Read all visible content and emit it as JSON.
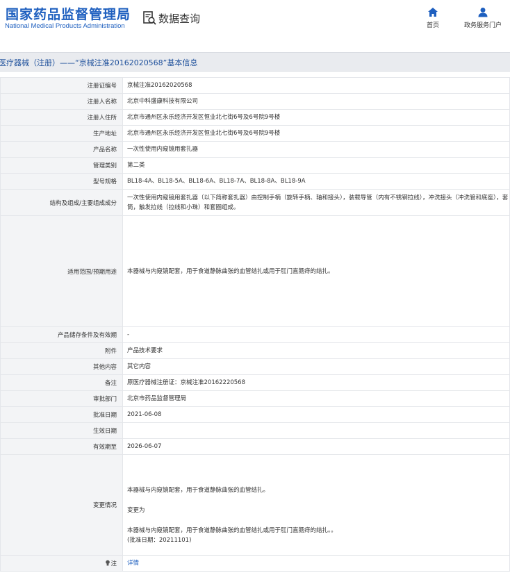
{
  "header": {
    "logo_cn": "国家药品监督管理局",
    "logo_en": "National Medical Products Administration",
    "data_query_label": "数据查询",
    "nav": [
      {
        "label": "首页",
        "icon": "home-icon"
      },
      {
        "label": "政务服务门户",
        "icon": "user-icon"
      }
    ]
  },
  "page": {
    "title": "医疗器械（注册）——“京械注准20162020568”基本信息"
  },
  "fields": {
    "reg_no": {
      "label": "注册证编号",
      "value": "京械注准20162020568"
    },
    "registrant": {
      "label": "注册人名称",
      "value": "北京中科盛康科技有限公司"
    },
    "registrant_addr": {
      "label": "注册人住所",
      "value": "北京市通州区永乐经济开发区恒业北七街6号及6号院9号楼"
    },
    "production_addr": {
      "label": "生产地址",
      "value": "北京市通州区永乐经济开发区恒业北七街6号及6号院9号楼"
    },
    "product_name": {
      "label": "产品名称",
      "value": "一次性使用内窥镜用套扎器"
    },
    "category": {
      "label": "管理类别",
      "value": "第二类"
    },
    "model": {
      "label": "型号规格",
      "value": "BL18-4A、BL18-5A、BL18-6A、BL18-7A、BL18-8A、BL18-9A"
    },
    "structure": {
      "label": "结构及组成/主要组成成分",
      "value": "一次性使用内窥镜用套扎器（以下简称套扎器）由控制手柄（旋转手柄、轴和接头），装载导管（内有不锈钢拉线），冲洗接头（冲洗管和底座），套筒，触发拉线（拉线和小珠）和套圈组成。"
    },
    "scope": {
      "label": "适用范围/预期用途",
      "value": "本器械与内窥镜配套，用于食道静脉曲张的血管结扎或用于肛门直肠痔的结扎。"
    },
    "storage": {
      "label": "产品储存条件及有效期",
      "value": "-"
    },
    "attachment": {
      "label": "附件",
      "value": "产品技术要求"
    },
    "other": {
      "label": "其他内容",
      "value": "其它内容"
    },
    "remark": {
      "label": "备注",
      "value": "原医疗器械注册证：京械注准20162220568"
    },
    "approval_dept": {
      "label": "审批部门",
      "value": "北京市药品监督管理局"
    },
    "approval_date": {
      "label": "批准日期",
      "value": "2021-06-08"
    },
    "effective_date": {
      "label": "生效日期",
      "value": ""
    },
    "valid_until": {
      "label": "有效期至",
      "value": "2026-06-07"
    },
    "change": {
      "label": "变更情况",
      "lines": [
        "本器械与内窥镜配套，用于食道静脉曲张的血管结扎。",
        "变更为",
        "本器械与内窥镜配套，用于食道静脉曲张的血管结扎或用于肛门直肠痔的结扎。。",
        "(批准日期：20211101)"
      ]
    },
    "note": {
      "label": "注",
      "value": "详情"
    }
  }
}
